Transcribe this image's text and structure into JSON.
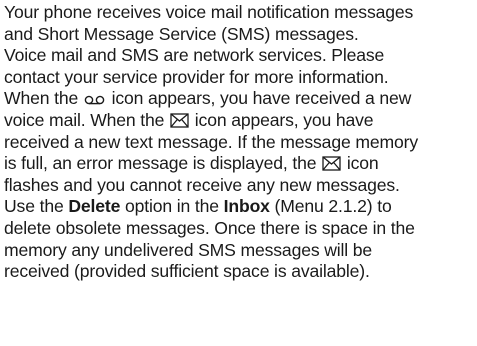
{
  "document": {
    "lines": [
      {
        "text": "Your phone receives voice mail notification messages"
      },
      {
        "text": "and Short Message Service (SMS) messages."
      },
      {
        "text": "Voice mail and SMS are network services. Please"
      },
      {
        "text": "contact your service provider for more information."
      },
      {
        "pre": "When the ",
        "icon": "voicemail-icon",
        "post": " icon appears, you have received a new"
      },
      {
        "pre": "voice mail. When the ",
        "icon": "envelope-icon",
        "post": " icon appears, you have"
      },
      {
        "text": "received a new text message. If the message memory"
      },
      {
        "pre": "is full, an error message is displayed, the ",
        "icon": "envelope-icon",
        "post": " icon"
      },
      {
        "text": "flashes and you cannot receive any new messages."
      },
      {
        "pre": "Use the ",
        "bold1": "Delete",
        "mid": " option in the ",
        "bold2": "Inbox",
        "post": " (Menu 2.1.2) to"
      },
      {
        "text": "delete obsolete messages. Once there is space in the"
      },
      {
        "text": "memory any undelivered SMS messages will be"
      },
      {
        "text": "received (provided sufficient space is available)."
      }
    ]
  }
}
